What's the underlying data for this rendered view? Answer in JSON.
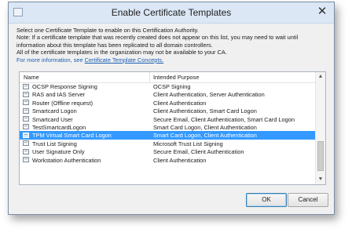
{
  "window": {
    "title": "Enable Certificate Templates",
    "close_glyph": "✕"
  },
  "description": {
    "lines": [
      "Select one Certificate Template to enable on this Certification Authority.",
      "Note: If a certificate template that was recently created does not appear on this list, you may need to wait until",
      "information about this template has been replicated to all domain controllers.",
      "All of the certificate templates in the organization may not be available to your CA."
    ],
    "more_info_prefix": "For more information, see ",
    "more_info_link": "Certificate Template Concepts.",
    "link_color": "#1a5fb4"
  },
  "list": {
    "columns": [
      "Name",
      "Intended Purpose"
    ],
    "selection_color": "#3399ff",
    "rows": [
      {
        "name": "OCSP Response Signing",
        "purpose": "OCSP Signing",
        "selected": false
      },
      {
        "name": "RAS and IAS Server",
        "purpose": "Client Authentication, Server Authentication",
        "selected": false
      },
      {
        "name": "Router (Offline request)",
        "purpose": "Client Authentication",
        "selected": false
      },
      {
        "name": "Smartcard Logon",
        "purpose": "Client Authentication, Smart Card Logon",
        "selected": false
      },
      {
        "name": "Smartcard User",
        "purpose": "Secure Email, Client Authentication, Smart Card Logon",
        "selected": false
      },
      {
        "name": "TestSmartcardLogon",
        "purpose": "Smart Card Logon, Client Authentication",
        "selected": false
      },
      {
        "name": "TPM Virtual Smart Card Logon",
        "purpose": "Smart Card Logon, Client Authentication",
        "selected": true
      },
      {
        "name": "Trust List Signing",
        "purpose": "Microsoft Trust List Signing",
        "selected": false
      },
      {
        "name": "User Signature Only",
        "purpose": "Secure Email, Client Authentication",
        "selected": false
      },
      {
        "name": "Workstation Authentication",
        "purpose": "Client Authentication",
        "selected": false
      }
    ],
    "scroll_up_glyph": "▲",
    "scroll_down_glyph": "▼"
  },
  "buttons": {
    "ok_label": "OK",
    "cancel_label": "Cancel"
  }
}
